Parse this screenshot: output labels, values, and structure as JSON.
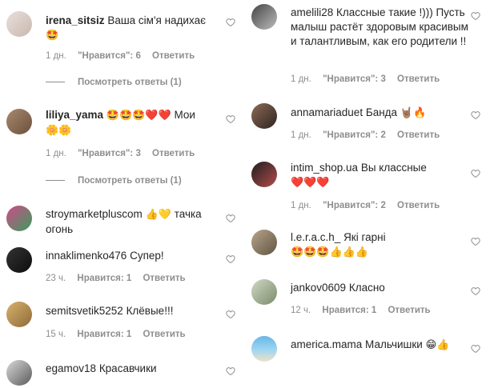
{
  "left": [
    {
      "user": "irena_sitsiz",
      "text": "Ваша сім'я надихає ",
      "emoji": "🤩",
      "time": "1 дн.",
      "likes": "\"Нравится\": 6",
      "reply": "Ответить",
      "view": "Посмотреть ответы (1)"
    },
    {
      "user": "liliya_yama",
      "text": "",
      "emoji": "🤩🤩🤩❤️❤️",
      "text2": "Мои ",
      "emoji2": "🌼🌼",
      "time": "1 дн.",
      "likes": "\"Нравится\": 3",
      "reply": "Ответить",
      "view": "Посмотреть ответы (1)"
    },
    {
      "user": "stroymarketplus­com",
      "text": "",
      "emoji": "👍💛",
      "text2": " тачка огонь",
      "time": "",
      "likes": "",
      "reply": ""
    },
    {
      "user": "innaklimenko476",
      "text": "Супер!",
      "time": "23 ч.",
      "likes": "Нравится: 1",
      "reply": "Ответить"
    },
    {
      "user": "semitsvetik5252",
      "text": "Клёвые!!!",
      "time": "15 ч.",
      "likes": "Нравится: 1",
      "reply": "Ответить"
    },
    {
      "user": "egamov18",
      "text": "Красавчики",
      "time": "",
      "likes": "",
      "reply": ""
    }
  ],
  "right": [
    {
      "user": "amelili28",
      "text": "Классные такие !))) Пусть малыш растёт здоровым красивым и талантливым, как его родители !!",
      "time": "1 дн.",
      "likes": "\"Нравится\": 3",
      "reply": "Ответить"
    },
    {
      "user": "annamariaduet",
      "text": "Банда ",
      "emoji": "🤘🏽🔥",
      "time": "1 дн.",
      "likes": "\"Нравится\": 2",
      "reply": "Ответить"
    },
    {
      "user": "intim_shop.ua",
      "text": "Вы классные ",
      "emoji": "❤️❤️❤️",
      "time": "1 дн.",
      "likes": "\"Нравится\": 2",
      "reply": "Ответить"
    },
    {
      "user": "l.e.r.a.c.h_",
      "text": "Які гарні",
      "emoji": "🤩🤩🤩👍👍👍",
      "time": "",
      "likes": "",
      "reply": ""
    },
    {
      "user": "jankov0609",
      "text": "Класно",
      "time": "12 ч.",
      "likes": "Нравится: 1",
      "reply": "Ответить"
    },
    {
      "user": "america.mama",
      "text": "Мальчишки ",
      "emoji": "😁👍",
      "time": "",
      "likes": "",
      "reply": ""
    }
  ],
  "icons": {
    "like": "heart-outline-icon"
  },
  "colors": {
    "text": "#262626",
    "meta": "#8e8e8e"
  }
}
